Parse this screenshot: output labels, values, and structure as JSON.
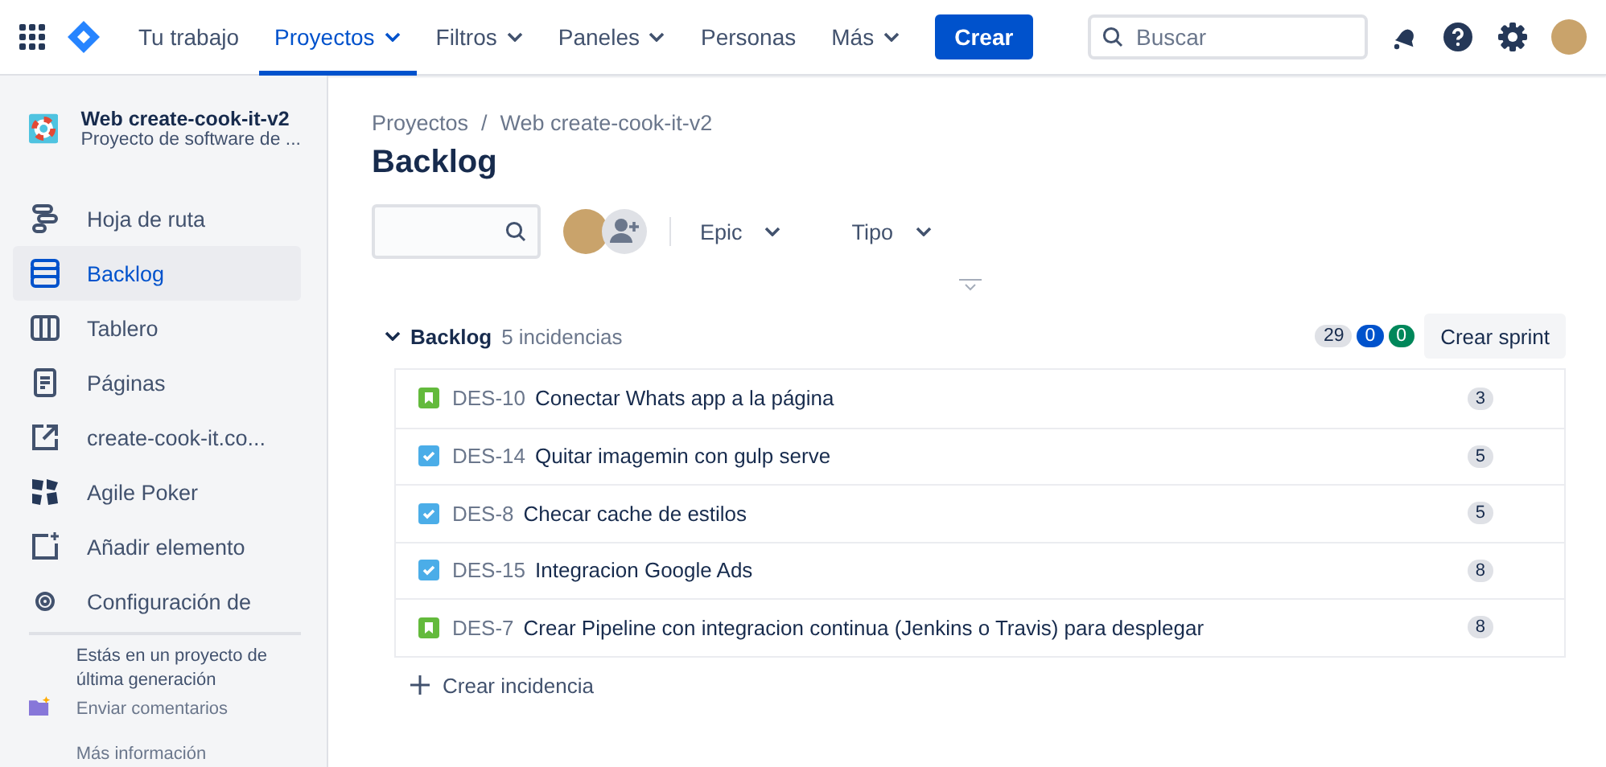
{
  "topnav": {
    "items": [
      {
        "label": "Tu trabajo",
        "selected": false,
        "dropdown": false
      },
      {
        "label": "Proyectos",
        "selected": true,
        "dropdown": true
      },
      {
        "label": "Filtros",
        "selected": false,
        "dropdown": true
      },
      {
        "label": "Paneles",
        "selected": false,
        "dropdown": true
      },
      {
        "label": "Personas",
        "selected": false,
        "dropdown": false
      },
      {
        "label": "Más",
        "selected": false,
        "dropdown": true
      }
    ],
    "create": "Crear",
    "search": {
      "placeholder": "Buscar"
    }
  },
  "sidebar": {
    "project": {
      "name": "Web create-cook-it-v2",
      "type": "Proyecto de software de ..."
    },
    "items": [
      {
        "label": "Hoja de ruta",
        "selected": false
      },
      {
        "label": "Backlog",
        "selected": true
      },
      {
        "label": "Tablero",
        "selected": false
      },
      {
        "label": "Páginas",
        "selected": false
      },
      {
        "label": "create-cook-it.co...",
        "selected": false
      },
      {
        "label": "Agile Poker",
        "selected": false
      },
      {
        "label": "Añadir elemento",
        "selected": false
      },
      {
        "label": "Configuración de",
        "selected": false
      }
    ],
    "footer": {
      "message": "Estás en un proyecto de última generación",
      "feedback": "Enviar comentarios",
      "more": "Más información"
    }
  },
  "breadcrumbs": {
    "separator": "/",
    "items": [
      "Proyectos",
      "Web create-cook-it-v2"
    ]
  },
  "title": "Backlog",
  "filters": [
    {
      "label": "Epic"
    },
    {
      "label": "Tipo"
    }
  ],
  "backlog": {
    "title": "Backlog",
    "count": "5 incidencias",
    "expanded": true,
    "totals": [
      {
        "value": "29",
        "color": "#dfe1e6"
      },
      {
        "value": "0",
        "color": "#0052cc"
      },
      {
        "value": "0",
        "color": "#00875a"
      }
    ],
    "create_sprint": "Crear sprint",
    "issues": [
      {
        "kind": "story",
        "key": "DES-10",
        "summary": "Conectar Whats app a la página",
        "points": "3"
      },
      {
        "kind": "task",
        "key": "DES-14",
        "summary": "Quitar imagemin con gulp serve",
        "points": "5"
      },
      {
        "kind": "task",
        "key": "DES-8",
        "summary": "Checar cache de estilos",
        "points": "5"
      },
      {
        "kind": "task",
        "key": "DES-15",
        "summary": "Integracion Google Ads",
        "points": "8"
      },
      {
        "kind": "story",
        "key": "DES-7",
        "summary": "Crear Pipeline con integracion continua (Jenkins o Travis) para desplegar",
        "points": "8"
      }
    ],
    "create_issue": "Crear incidencia"
  }
}
